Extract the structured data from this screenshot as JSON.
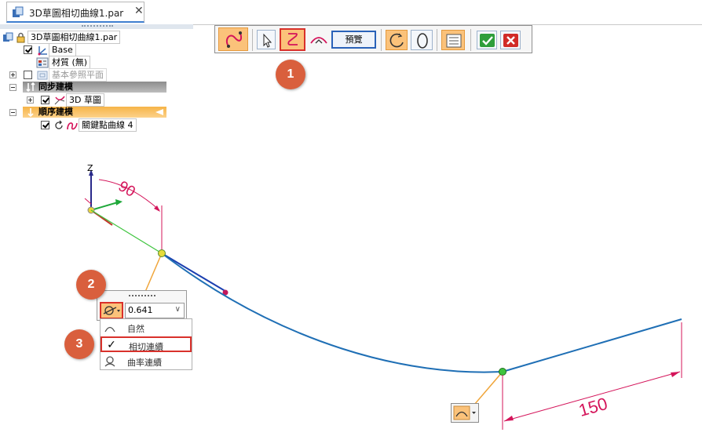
{
  "document_tab": {
    "title": "3D草圖相切曲線1.par",
    "close_glyph": "✕"
  },
  "tree": {
    "root": "3D草圖相切曲線1.par",
    "base": "Base",
    "material": "材質 (無)",
    "ref_planes": "基本參照平面",
    "sync_section": "同步建模",
    "sketch3d": "3D 草圖",
    "ordered_section": "順序建模",
    "keypoint_curve": "關鍵點曲線 4"
  },
  "command_bar": {
    "preview_label": "預覽",
    "buttons": [
      "curve-step-icon",
      "select-arrow-icon",
      "tangent-curve-icon",
      "curve-edit-icon",
      "preview-button",
      "open-curve-icon",
      "closed-curve-icon",
      "options-list-icon",
      "accept-icon",
      "cancel-icon"
    ]
  },
  "callouts": [
    "1",
    "2",
    "3"
  ],
  "dimensions": {
    "angle": "90",
    "length": "150"
  },
  "axis": {
    "z_label": "Z"
  },
  "continuity_box": {
    "value": "0.641",
    "options": [
      {
        "label": "自然",
        "icon": "natural-end-icon",
        "selected": false
      },
      {
        "label": "相切連續",
        "icon": "check-icon",
        "selected": true
      },
      {
        "label": "曲率連續",
        "icon": "curvature-icon",
        "selected": false
      }
    ]
  },
  "colors": {
    "curve": "#1f6fb5",
    "dimension": "#d4145a",
    "highlight_red": "#d9312b",
    "callout": "#d95f3d",
    "active_orange": "#fbc27a"
  }
}
